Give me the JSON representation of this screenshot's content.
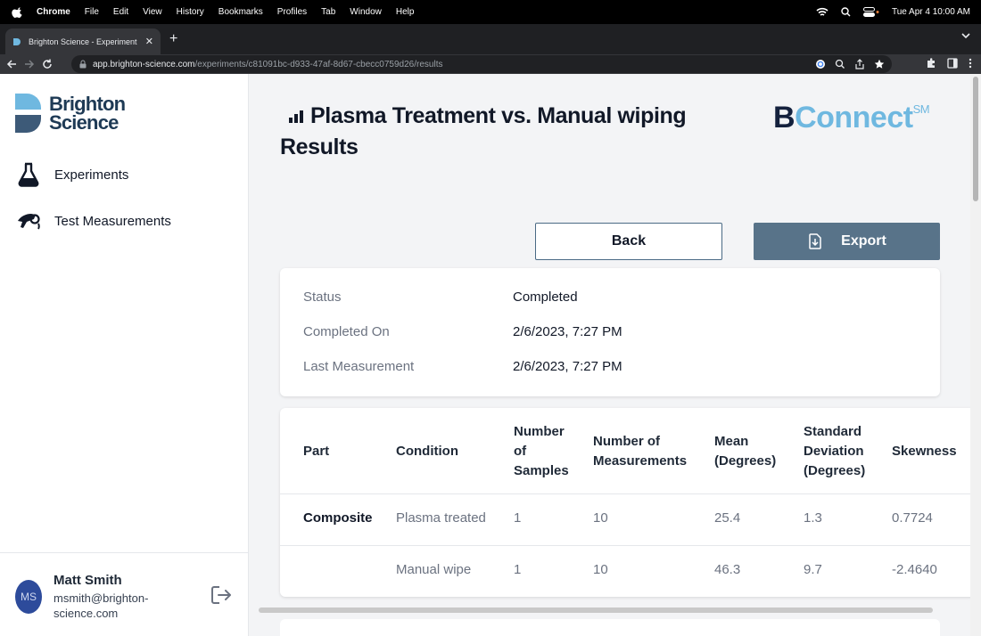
{
  "menubar": {
    "items": [
      "Chrome",
      "File",
      "Edit",
      "View",
      "History",
      "Bookmarks",
      "Profiles",
      "Tab",
      "Window",
      "Help"
    ],
    "datetime": "Tue Apr 4  10:00 AM"
  },
  "browser": {
    "tab_title": "Brighton Science - Experiment",
    "url_host": "app.brighton-science.com",
    "url_path": "/experiments/c81091bc-d933-47af-8d67-cbecc0759d26/results"
  },
  "sidebar": {
    "logo_line1": "Brighton",
    "logo_line2": "Science",
    "nav": [
      {
        "label": "Experiments",
        "icon": "flask-icon"
      },
      {
        "label": "Test Measurements",
        "icon": "measurement-device-icon"
      }
    ],
    "user": {
      "initials": "MS",
      "name": "Matt Smith",
      "email": "msmith@brighton-science.com"
    }
  },
  "header": {
    "title": "Plasma Treatment vs. Manual wiping Results",
    "brand_b": "B",
    "brand_rest": "Connect",
    "brand_sup": "SM"
  },
  "actions": {
    "back_label": "Back",
    "export_label": "Export"
  },
  "status": [
    {
      "label": "Status",
      "value": "Completed"
    },
    {
      "label": "Completed On",
      "value": "2/6/2023, 7:27 PM"
    },
    {
      "label": "Last Measurement",
      "value": "2/6/2023, 7:27 PM"
    }
  ],
  "results_table": {
    "columns": [
      "Part",
      "Condition",
      "Number of Samples",
      "Number of Measurements",
      "Mean (Degrees)",
      "Standard Deviation (Degrees)",
      "Skewness"
    ],
    "rows": [
      [
        "Composite",
        "Plasma treated",
        "1",
        "10",
        "25.4",
        "1.3",
        "0.7724"
      ],
      [
        "",
        "Manual wipe",
        "1",
        "10",
        "46.3",
        "9.7",
        "-2.4640"
      ]
    ]
  },
  "colors": {
    "brand_dark": "#14213d",
    "brand_light": "#6fb8e0",
    "export_button": "#587389",
    "avatar": "#2d4b9b"
  }
}
